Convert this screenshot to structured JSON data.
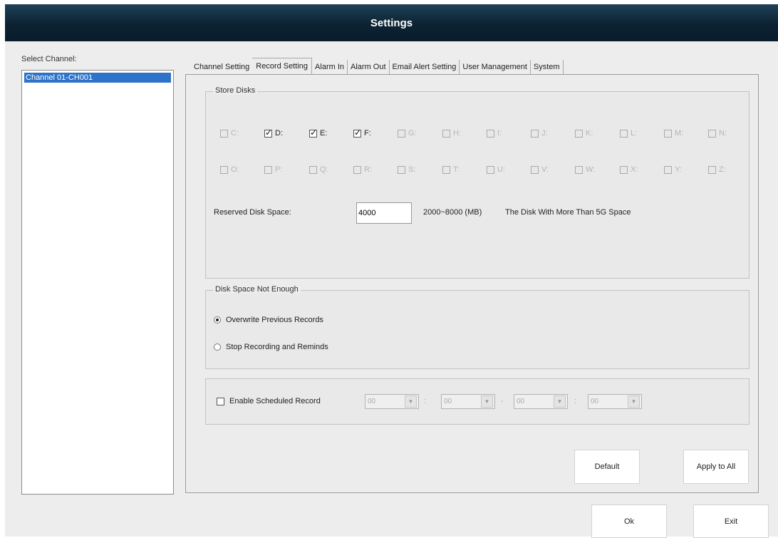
{
  "window": {
    "title": "Settings"
  },
  "channels": {
    "label": "Select Channel:",
    "items": [
      "Channel 01-CH001"
    ]
  },
  "tabs": [
    {
      "label": "Channel Setting",
      "active": false
    },
    {
      "label": "Record Setting",
      "active": true
    },
    {
      "label": "Alarm In",
      "active": false
    },
    {
      "label": "Alarm Out",
      "active": false
    },
    {
      "label": "Email Alert Setting",
      "active": false
    },
    {
      "label": "User Management",
      "active": false
    },
    {
      "label": "System",
      "active": false
    }
  ],
  "store_disks": {
    "title": "Store Disks",
    "drives": [
      {
        "label": "C:",
        "checked": false,
        "enabled": false
      },
      {
        "label": "D:",
        "checked": true,
        "enabled": true
      },
      {
        "label": "E:",
        "checked": true,
        "enabled": true
      },
      {
        "label": "F:",
        "checked": true,
        "enabled": true
      },
      {
        "label": "G:",
        "checked": false,
        "enabled": false
      },
      {
        "label": "H:",
        "checked": false,
        "enabled": false
      },
      {
        "label": "I:",
        "checked": false,
        "enabled": false
      },
      {
        "label": "J:",
        "checked": false,
        "enabled": false
      },
      {
        "label": "K:",
        "checked": false,
        "enabled": false
      },
      {
        "label": "L:",
        "checked": false,
        "enabled": false
      },
      {
        "label": "M:",
        "checked": false,
        "enabled": false
      },
      {
        "label": "N:",
        "checked": false,
        "enabled": false
      },
      {
        "label": "O:",
        "checked": false,
        "enabled": false
      },
      {
        "label": "P:",
        "checked": false,
        "enabled": false
      },
      {
        "label": "Q:",
        "checked": false,
        "enabled": false
      },
      {
        "label": "R:",
        "checked": false,
        "enabled": false
      },
      {
        "label": "S:",
        "checked": false,
        "enabled": false
      },
      {
        "label": "T:",
        "checked": false,
        "enabled": false
      },
      {
        "label": "U:",
        "checked": false,
        "enabled": false
      },
      {
        "label": "V:",
        "checked": false,
        "enabled": false
      },
      {
        "label": "W:",
        "checked": false,
        "enabled": false
      },
      {
        "label": "X:",
        "checked": false,
        "enabled": false
      },
      {
        "label": "Y:",
        "checked": false,
        "enabled": false
      },
      {
        "label": "Z:",
        "checked": false,
        "enabled": false
      }
    ],
    "reserved_label": "Reserved Disk Space:",
    "reserved_value": "4000",
    "reserved_range": "2000~8000 (MB)",
    "reserved_note": "The Disk With More Than 5G Space"
  },
  "disk_space": {
    "title": "Disk Space Not Enough",
    "options": [
      {
        "label": "Overwrite Previous Records",
        "checked": true
      },
      {
        "label": "Stop Recording and Reminds",
        "checked": false
      }
    ]
  },
  "schedule": {
    "label": "Enable Scheduled Record",
    "enabled": false,
    "start_hour": "00",
    "start_minute": "00",
    "end_hour": "00",
    "end_minute": "00",
    "sep_colon": ":",
    "sep_dash": "-"
  },
  "buttons": {
    "default": "Default",
    "apply_all": "Apply to All",
    "ok": "Ok",
    "exit": "Exit"
  },
  "colors": {
    "titlebar": "#0c2233",
    "selection": "#2e73c9"
  }
}
